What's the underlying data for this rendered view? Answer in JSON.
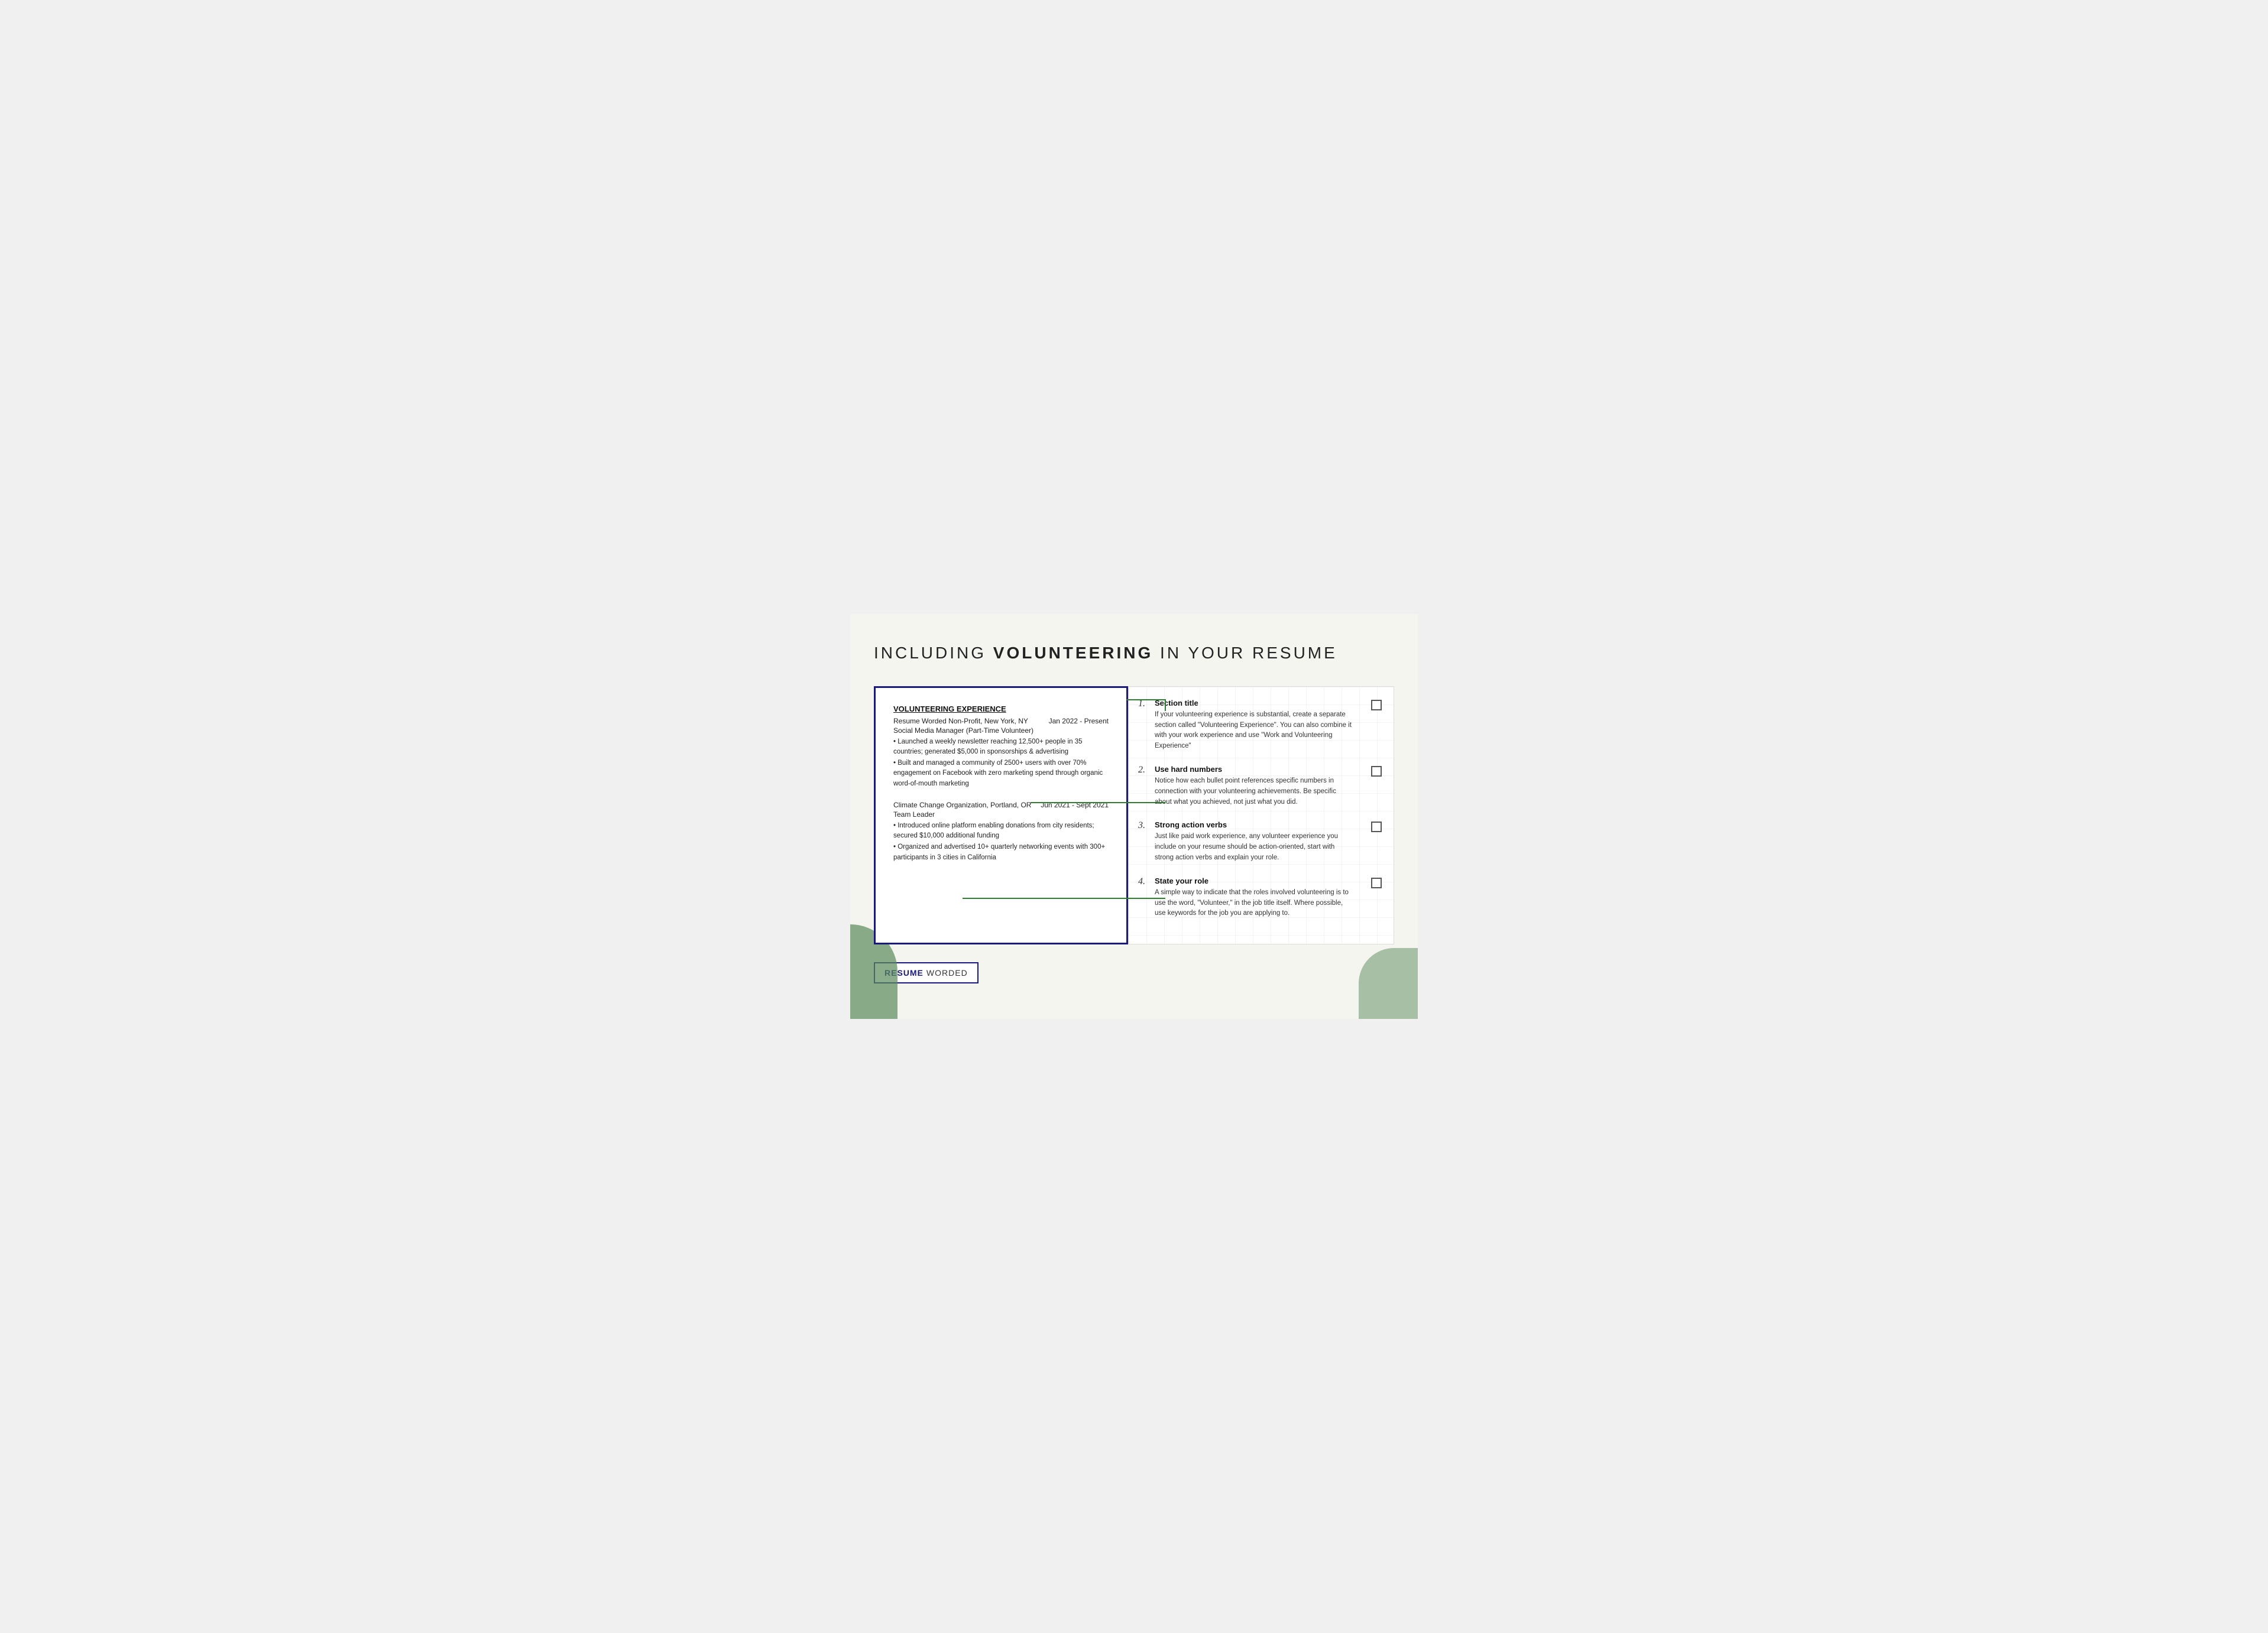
{
  "page": {
    "title_part1": "INCLUDING ",
    "title_bold": "VOLUNTEERING",
    "title_part2": " IN YOUR RESUME"
  },
  "resume": {
    "section_title": "VOLUNTEERING EXPERIENCE",
    "entries": [
      {
        "org": "Resume Worded Non-Profit, New York, NY",
        "date": "Jan 2022 - Present",
        "role": "Social Media Manager (Part-Time Volunteer)",
        "bullets": [
          "• Launched a weekly newsletter reaching 12,500+ people in 35 countries; generated $5,000 in sponsorships & advertising",
          "• Built and managed a community of 2500+ users with over 70% engagement on Facebook with zero marketing spend through organic word-of-mouth marketing"
        ]
      },
      {
        "org": "Climate Change Organization, Portland, OR",
        "date": "Jun 2021 - Sept 2021",
        "role": "Team Leader",
        "bullets": [
          "• Introduced online platform enabling donations from city residents; secured $10,000 additional funding",
          "• Organized and advertised 10+ quarterly networking events with 300+ participants in 3 cities in California"
        ]
      }
    ]
  },
  "tips": [
    {
      "number": "1.",
      "title": "Section title",
      "description": "If your volunteering experience is substantial, create a separate section called \"Volunteering Experience\". You can also combine it with your work experience and use \"Work and Volunteering Experience\""
    },
    {
      "number": "2.",
      "title": "Use hard numbers",
      "description": "Notice how each bullet point references specific numbers in connection with your volunteering achievements. Be specific about what you achieved, not just what you did."
    },
    {
      "number": "3.",
      "title": "Strong action verbs",
      "description": "Just like paid work experience, any volunteer experience you include on your resume should be action-oriented, start with strong action verbs and explain your role."
    },
    {
      "number": "4.",
      "title": "State your role",
      "description": "A simple way to indicate that the roles involved volunteering is to use the word, \"Volunteer,\" in the job title itself. Where possible, use keywords for the job you are applying to."
    }
  ],
  "branding": {
    "resume": "RESUME",
    "worded": "WORDED"
  }
}
